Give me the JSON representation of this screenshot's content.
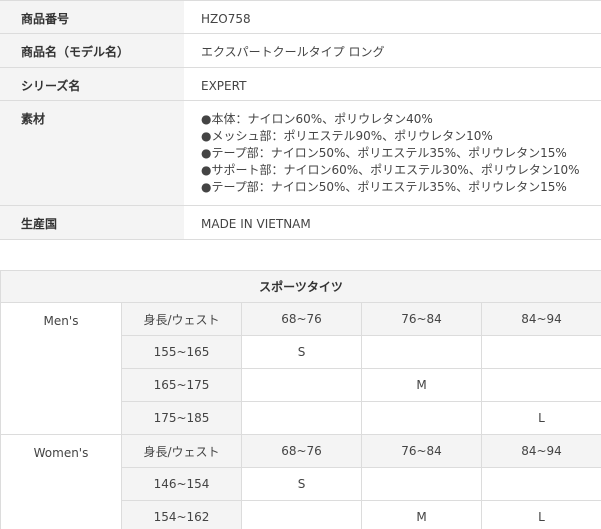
{
  "spec": {
    "rows": [
      {
        "label": "商品番号",
        "value": "HZO758"
      },
      {
        "label": "商品名（モデル名）",
        "value": "エクスパートクールタイプ ロング"
      },
      {
        "label": "シリーズ名",
        "value": "EXPERT"
      },
      {
        "label": "素材",
        "lines": [
          "●本体：ナイロン60%、ポリウレタン40%",
          "●メッシュ部：ポリエステル90%、ポリウレタン10%",
          "●テープ部：ナイロン50%、ポリエステル35%、ポリウレタン15%",
          "●サポート部：ナイロン60%、ポリエステル30%、ポリウレタン10%",
          "●テープ部：ナイロン50%、ポリエステル35%、ポリウレタン15%"
        ]
      },
      {
        "label": "生産国",
        "value": "MADE IN VIETNAM"
      }
    ]
  },
  "size_table": {
    "title": "スポーツタイツ",
    "groups": [
      {
        "name": "Men's",
        "header": {
          "label": "身長/ウェスト",
          "cols": [
            "68~76",
            "76~84",
            "84~94"
          ]
        },
        "rows": [
          {
            "label": "155~165",
            "cells": [
              "S",
              "",
              ""
            ]
          },
          {
            "label": "165~175",
            "cells": [
              "",
              "M",
              ""
            ]
          },
          {
            "label": "175~185",
            "cells": [
              "",
              "",
              "L"
            ]
          }
        ]
      },
      {
        "name": "Women's",
        "header": {
          "label": "身長/ウェスト",
          "cols": [
            "68~76",
            "76~84",
            "84~94"
          ]
        },
        "rows": [
          {
            "label": "146~154",
            "cells": [
              "S",
              "",
              ""
            ]
          },
          {
            "label": "154~162",
            "cells": [
              "",
              "M",
              "L"
            ]
          }
        ]
      }
    ]
  }
}
